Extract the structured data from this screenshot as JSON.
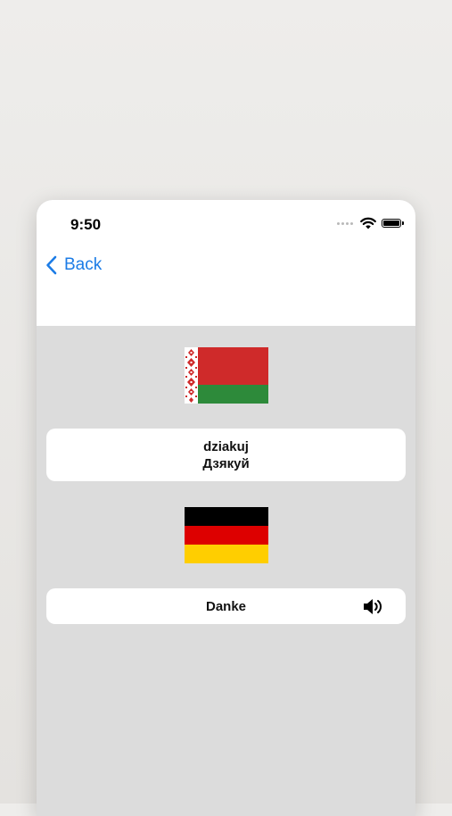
{
  "status_bar": {
    "time": "9:50"
  },
  "nav": {
    "back_label": "Back"
  },
  "source": {
    "flag": "belarus-flag",
    "word": "dziakuj",
    "word_cyrillic": "Дзякуй"
  },
  "target": {
    "flag": "germany-flag",
    "word": "Danke",
    "audio_icon": "speaker-icon"
  },
  "colors": {
    "accent": "#1c7ce6",
    "background": "#dcdcdc",
    "belarus_red": "#cf2a2a",
    "belarus_green": "#2d8a3a",
    "germany_black": "#000000",
    "germany_red": "#dd0000",
    "germany_gold": "#ffce00"
  }
}
